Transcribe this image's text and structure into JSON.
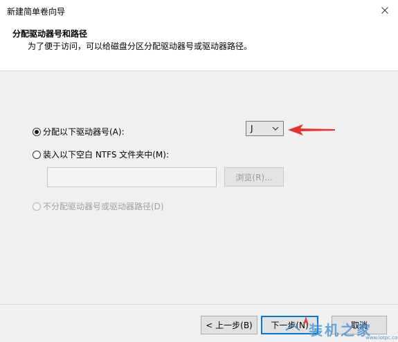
{
  "window": {
    "title": "新建简单卷向导"
  },
  "header": {
    "title": "分配驱动器号和路径",
    "subtitle": "为了便于访问，可以给磁盘分区分配驱动器号或驱动器路径。"
  },
  "options": {
    "assign_letter": {
      "label": "分配以下驱动器号(A):",
      "selected": true
    },
    "mount_folder": {
      "label": "装入以下空白 NTFS 文件夹中(M):",
      "selected": false
    },
    "no_assign": {
      "label": "不分配驱动器号或驱动器路径(D)",
      "selected": false,
      "disabled": true
    }
  },
  "drive_select": {
    "value": "J"
  },
  "folder_path": {
    "value": "",
    "browse_label": "浏览(R)..."
  },
  "footer": {
    "back_label": "< 上一步(B)",
    "next_label": "下一步(N)",
    "cancel_label": "取消"
  },
  "watermark": {
    "text": "装机之家",
    "url": "www.lotpc.com"
  },
  "colors": {
    "annotation_arrow": "#e8322b",
    "primary_border": "#0078d7",
    "watermark": "#3f8fd8"
  }
}
